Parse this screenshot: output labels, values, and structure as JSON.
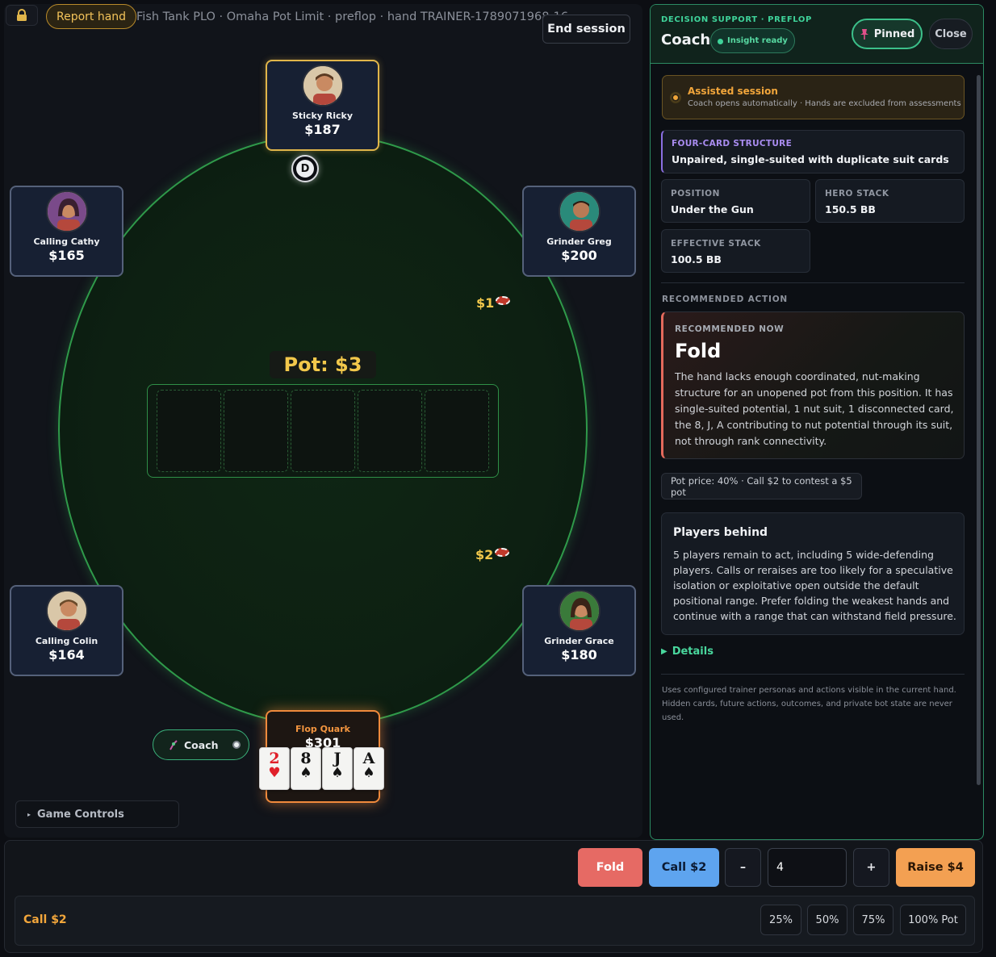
{
  "topbar": {
    "report_label": "Report hand",
    "hand_title": "Fish Tank PLO · Omaha Pot Limit · preflop · hand TRAINER-1789071968-16",
    "end_session_label": "End session"
  },
  "table": {
    "pot_label": "Pot: $3",
    "dealer_label": "D",
    "bets": [
      "$1",
      "$2"
    ],
    "seats": [
      {
        "name": "Sticky Ricky",
        "stack": "$187"
      },
      {
        "name": "Calling Cathy",
        "stack": "$165"
      },
      {
        "name": "Grinder Greg",
        "stack": "$200"
      },
      {
        "name": "Calling Colin",
        "stack": "$164"
      },
      {
        "name": "Grinder Grace",
        "stack": "$180"
      }
    ],
    "hero": {
      "name": "Flop Quark",
      "stack": "$301"
    },
    "hero_cards": [
      {
        "rank": "2",
        "suit": "♥"
      },
      {
        "rank": "8",
        "suit": "♠"
      },
      {
        "rank": "J",
        "suit": "♠"
      },
      {
        "rank": "A",
        "suit": "♠"
      }
    ],
    "coach_pill_label": "Coach",
    "game_controls_label": "Game Controls"
  },
  "coach": {
    "kicker": "DECISION SUPPORT · PREFLOP",
    "title": "Coach",
    "insight_badge": "Insight ready",
    "pinned_label": "Pinned",
    "close_label": "Close",
    "assisted_title": "Assisted session",
    "assisted_sub": "Coach opens automatically · Hands are excluded from assessments",
    "structure_label": "FOUR-CARD STRUCTURE",
    "structure_value": "Unpaired, single-suited with duplicate suit cards",
    "position_label": "POSITION",
    "position_value": "Under the Gun",
    "hero_stack_label": "HERO STACK",
    "hero_stack_value": "150.5 BB",
    "effective_stack_label": "EFFECTIVE STACK",
    "effective_stack_value": "100.5 BB",
    "recommended_heading": "RECOMMENDED ACTION",
    "recommended_now_label": "RECOMMENDED NOW",
    "recommended_action": "Fold",
    "recommended_desc": "The hand lacks enough coordinated, nut-making structure for an unopened pot from this position. It has single-suited potential, 1 nut suit, 1 disconnected card, the 8, J, A contributing to nut potential through its suit, not through rank connectivity.",
    "pot_price": "Pot price: 40% · Call $2 to contest a $5 pot",
    "players_behind_title": "Players behind",
    "players_behind_desc": "5 players remain to act, including 5 wide-defending players. Calls or reraises are too likely for a speculative isolation or exploitative open outside the default positional range. Prefer folding the weakest hands and continue with a range that can withstand field pressure.",
    "details_label": "Details",
    "footnote": "Uses configured trainer personas and actions visible in the current hand. Hidden cards, future actions, outcomes, and private bot state are never used."
  },
  "actions": {
    "fold_label": "Fold",
    "call_label": "Call $2",
    "minus_label": "–",
    "raise_amount": "4",
    "plus_label": "+",
    "raise_label": "Raise $4",
    "sizing_label": "Call $2",
    "pot_sizes": [
      "25%",
      "50%",
      "75%",
      "100% Pot"
    ]
  },
  "colors": {
    "felt_line": "#2f9a4a",
    "hero_glow": "#f08a3c",
    "coach_accent": "#3fd39a",
    "fold": "#e66a64",
    "call": "#5ea4ef",
    "raise": "#f3a052"
  },
  "icons": {
    "lock": "lock-icon",
    "pin": "pin-icon",
    "coach": "coach-icon",
    "details_caret": "caret-right-icon",
    "game_controls_caret": "caret-right-icon"
  }
}
